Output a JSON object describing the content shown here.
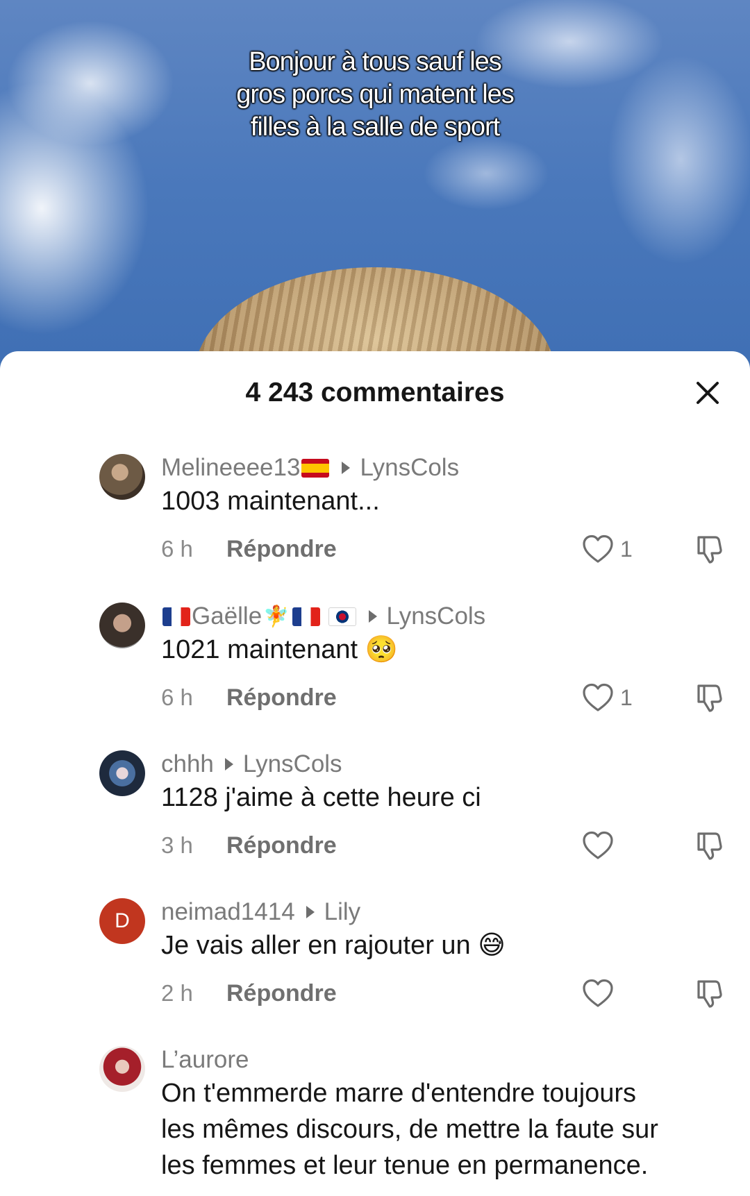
{
  "video": {
    "overlay_lines": [
      "Bonjour à tous sauf les",
      "gros porcs qui matent les",
      "filles à la salle de sport"
    ]
  },
  "sheet": {
    "title": "4 243 commentaires",
    "close_icon": "close-icon"
  },
  "comments": [
    {
      "username": "Melineeee13",
      "username_suffix_flag": "flag-es",
      "reply_to": "LynsCols",
      "text": "1003 maintenant...",
      "time": "6 h",
      "reply_label": "Répondre",
      "likes": "1"
    },
    {
      "username": "Gaëlle",
      "username_prefix_flag": "flag-fr",
      "username_extra": "🧚",
      "reply_to": "LynsCols",
      "text": "1021 maintenant",
      "emoji": "🥺",
      "time": "6 h",
      "reply_label": "Répondre",
      "likes": "1"
    },
    {
      "username": "chhh",
      "reply_to": "LynsCols",
      "text": "1128 j'aime à cette heure ci",
      "time": "3 h",
      "reply_label": "Répondre",
      "likes": ""
    },
    {
      "username": "neimad1414",
      "avatar_letter": "D",
      "avatar_color": "#c1361f",
      "reply_to": "Lily",
      "text": "Je vais aller en rajouter un",
      "emoji": "😅",
      "time": "2 h",
      "reply_label": "Répondre",
      "likes": ""
    },
    {
      "username": "L’aurore",
      "text_lines": [
        "On t'emmerde marre d'entendre toujours",
        "les mêmes discours, de mettre la faute sur",
        "les femmes et leur tenue en permanence."
      ]
    }
  ],
  "colors": {
    "text_primary": "#161616",
    "text_secondary": "#7a7a7a",
    "sky": "#4a78bb"
  }
}
